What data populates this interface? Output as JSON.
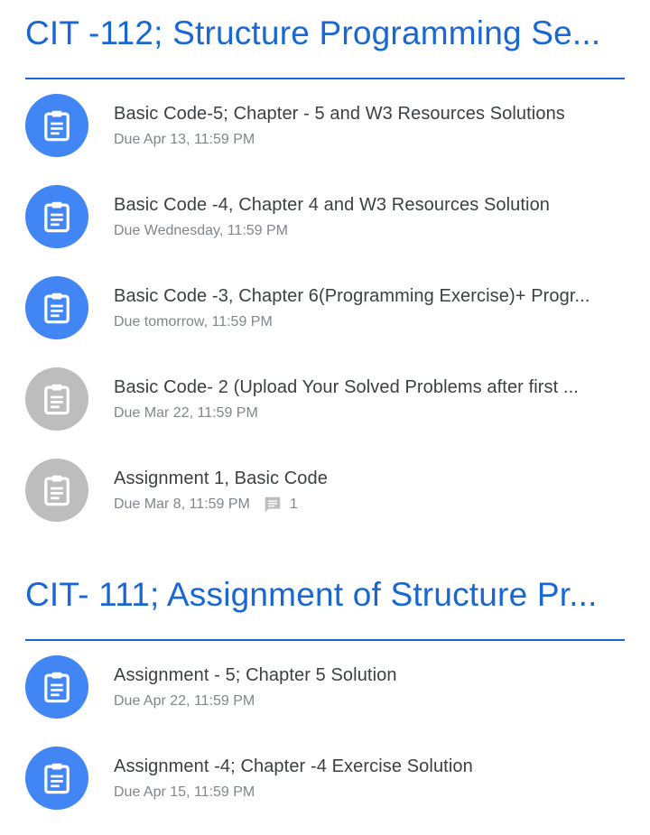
{
  "colors": {
    "accent": "#1967d2",
    "icon_active": "#4285f4",
    "icon_inactive": "#bdbdbd",
    "title_text": "#3c4043",
    "meta_text": "#80868b"
  },
  "topics": [
    {
      "title": "CIT -112; Structure Programming Se...",
      "items": [
        {
          "title": "Basic Code-5; Chapter - 5 and W3 Resources  Solutions",
          "due": "Due Apr 13, 11:59 PM",
          "icon": "assignment-icon",
          "state": "active"
        },
        {
          "title": "Basic Code -4, Chapter 4 and W3 Resources Solution",
          "due": "Due Wednesday, 11:59 PM",
          "icon": "assignment-icon",
          "state": "active"
        },
        {
          "title": "Basic Code -3, Chapter 6(Programming Exercise)+ Progr...",
          "due": "Due tomorrow, 11:59 PM",
          "icon": "assignment-icon",
          "state": "active"
        },
        {
          "title": "Basic Code-  2 (Upload Your Solved Problems after first ...",
          "due": "Due Mar 22, 11:59 PM",
          "icon": "assignment-icon",
          "state": "inactive"
        },
        {
          "title": "Assignment 1, Basic Code",
          "due": "Due Mar 8, 11:59 PM",
          "icon": "assignment-icon",
          "state": "inactive",
          "comment_icon": "comment-icon",
          "comment_count": "1"
        }
      ]
    },
    {
      "title": "CIT- 111; Assignment of Structure Pr...",
      "items": [
        {
          "title": "Assignment - 5; Chapter 5 Solution",
          "due": "Due Apr 22, 11:59 PM",
          "icon": "assignment-icon",
          "state": "active"
        },
        {
          "title": "Assignment -4; Chapter -4 Exercise Solution",
          "due": "Due Apr 15, 11:59 PM",
          "icon": "assignment-icon",
          "state": "active"
        }
      ]
    }
  ]
}
